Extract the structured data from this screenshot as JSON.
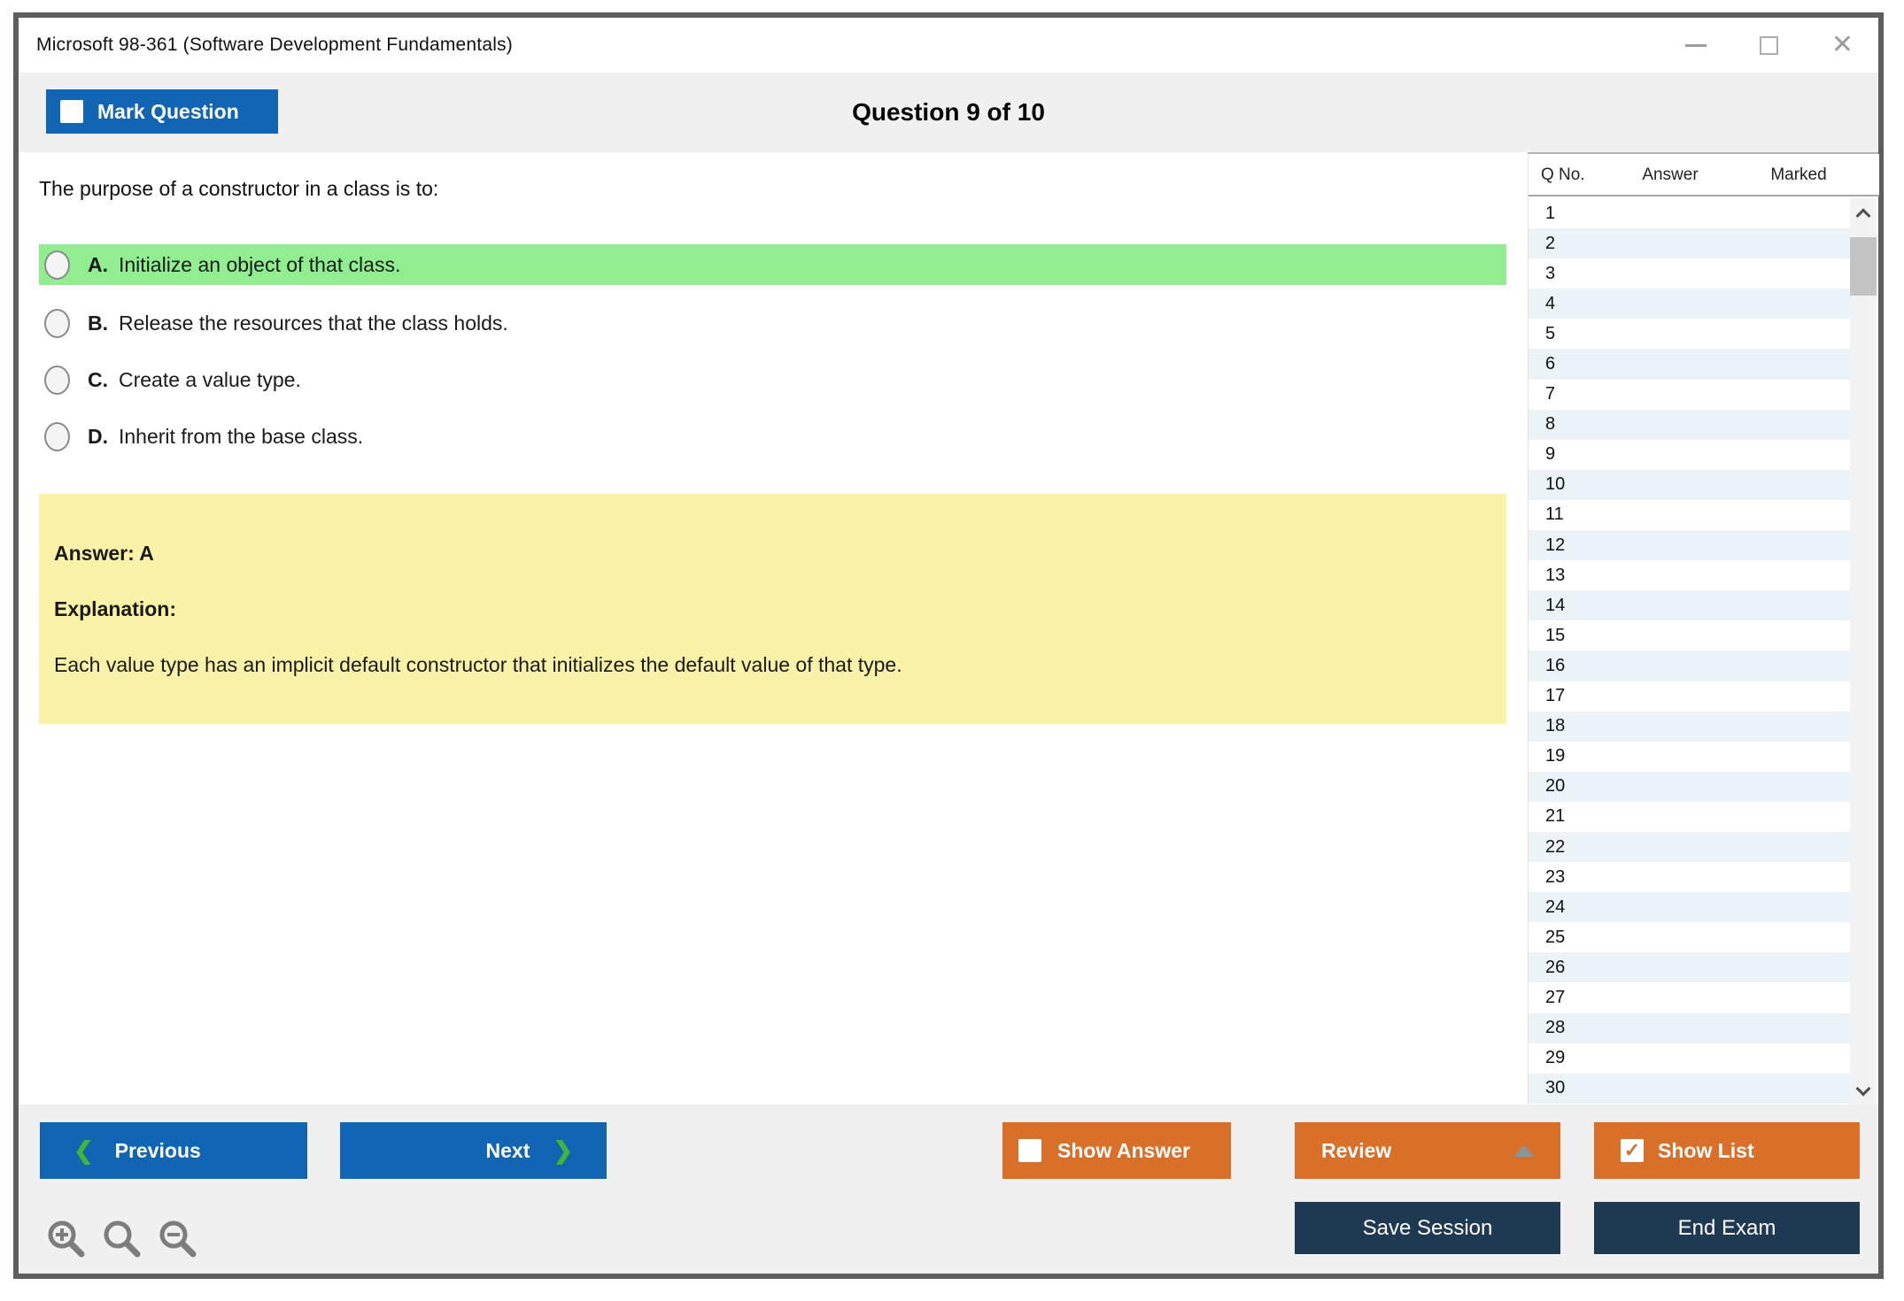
{
  "window": {
    "title": "Microsoft 98-361 (Software Development Fundamentals)"
  },
  "header": {
    "mark_question_label": "Mark Question",
    "mark_question_checked": false,
    "question_counter": "Question 9 of 10"
  },
  "question": {
    "text": "The purpose of a constructor in a class is to:",
    "options": [
      {
        "letter": "A.",
        "text": "Initialize an object of that class.",
        "highlighted": true
      },
      {
        "letter": "B.",
        "text": "Release the resources that the class holds.",
        "highlighted": false
      },
      {
        "letter": "C.",
        "text": "Create a value type.",
        "highlighted": false
      },
      {
        "letter": "D.",
        "text": "Inherit from the base class.",
        "highlighted": false
      }
    ],
    "answer_label": "Answer: A",
    "explanation_label": "Explanation:",
    "explanation_text": "Each value type has an implicit default constructor that initializes the default value of that type."
  },
  "question_list": {
    "columns": {
      "qno": "Q No.",
      "answer": "Answer",
      "marked": "Marked"
    },
    "rows": [
      "1",
      "2",
      "3",
      "4",
      "5",
      "6",
      "7",
      "8",
      "9",
      "10",
      "11",
      "12",
      "13",
      "14",
      "15",
      "16",
      "17",
      "18",
      "19",
      "20",
      "21",
      "22",
      "23",
      "24",
      "25",
      "26",
      "27",
      "28",
      "29",
      "30"
    ]
  },
  "toolbar": {
    "previous_label": "Previous",
    "next_label": "Next",
    "show_answer_label": "Show Answer",
    "show_answer_checked": false,
    "review_label": "Review",
    "show_list_label": "Show List",
    "show_list_checked": true,
    "save_session_label": "Save Session",
    "end_exam_label": "End Exam"
  },
  "icons": {
    "check": "✓",
    "chevron_left": "❮",
    "chevron_right": "❯",
    "close": "✕"
  },
  "colors": {
    "blue": "#1165b3",
    "orange": "#d8702a",
    "navy": "#1e3a52",
    "highlight_green": "#90ee90",
    "explanation_yellow": "#faf2a6",
    "alt_row_blue": "#ebf2f8",
    "band_gray": "#f0f0f0"
  }
}
